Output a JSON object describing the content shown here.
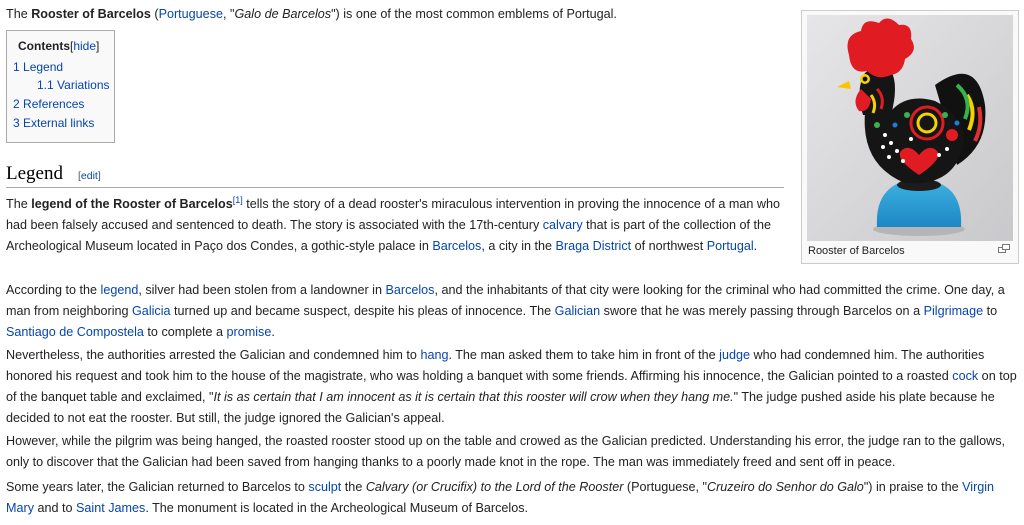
{
  "intro": {
    "t1": "The ",
    "b1": "Rooster of Barcelos",
    "t2": " (",
    "l1": "Portuguese",
    "t3": ", \"",
    "i1": "Galo de Barcelos",
    "t4": "\") is one of the most common emblems of Portugal."
  },
  "toc": {
    "title": "Contents",
    "hide_open": "[",
    "hide_label": "hide",
    "hide_close": "]",
    "items": [
      {
        "num": "1",
        "label": "Legend"
      },
      {
        "num": "1.1",
        "label": "Variations"
      },
      {
        "num": "2",
        "label": "References"
      },
      {
        "num": "3",
        "label": "External links"
      }
    ]
  },
  "heading": {
    "text": "Legend",
    "edit_open": "[",
    "edit_label": "edit",
    "edit_close": "]"
  },
  "thumb": {
    "caption": "Rooster of Barcelos",
    "magnify_icon": "magnify-clip-icon"
  },
  "p1": {
    "t1": "The ",
    "b1": "legend of the Rooster of Barcelos",
    "ref": "[1]",
    "t2": " tells the story of a dead rooster's miraculous intervention in proving the innocence of a man who had been falsely accused and sentenced to death. The story is associated with the 17th-century ",
    "l1": "calvary",
    "t3": " that is part of the collection of the Archeological Museum located in Paço dos Condes, a gothic-style palace in ",
    "l2": "Barcelos",
    "t4": ", a city in the ",
    "l3": "Braga District",
    "t5": " of northwest ",
    "l4": "Portugal",
    "t6": "."
  },
  "p2": {
    "t1": "According to the ",
    "l1": "legend",
    "t2": ", silver had been stolen from a landowner in ",
    "l2": "Barcelos",
    "t3": ", and the inhabitants of that city were looking for the criminal who had committed the crime. One day, a man from neighboring ",
    "l3": "Galicia",
    "t4": " turned up and became suspect, despite his pleas of innocence. The ",
    "l4": "Galician",
    "t5": " swore that he was merely passing through Barcelos on a ",
    "l5": "Pilgrimage",
    "t6": " to ",
    "l6": "Santiago de Compostela",
    "t7": " to complete a ",
    "l7": "promise",
    "t8": "."
  },
  "p3": {
    "t1": "Nevertheless, the authorities arrested the Galician and condemned him to ",
    "l1": "hang",
    "t2": ". The man asked them to take him in front of the ",
    "l2": "judge",
    "t3": " who had condemned him. The authorities honored his request and took him to the house of the magistrate, who was holding a banquet with some friends. Affirming his innocence, the Galician pointed to a roasted ",
    "l3": "cock",
    "t4": " on top of the banquet table and exclaimed, \"",
    "i1": "It is as certain that I am innocent as it is certain that this rooster will crow when they hang me.",
    "t5": "\" The judge pushed aside his plate because he decided to not eat the rooster. But still, the judge ignored the Galician's appeal."
  },
  "p4": {
    "text": "However, while the pilgrim was being hanged, the roasted rooster stood up on the table and crowed as the Galician predicted. Understanding his error, the judge ran to the gallows, only to discover that the Galician had been saved from hanging thanks to a poorly made knot in the rope. The man was immediately freed and sent off in peace."
  },
  "p5": {
    "t1": "Some years later, the Galician returned to Barcelos to ",
    "l1": "sculpt",
    "t2": " the ",
    "i1": "Calvary (or Crucifix) to the Lord of the Rooster",
    "t3": " (Portuguese, \"",
    "i2": "Cruzeiro do Senhor do Galo",
    "t4": "\") in praise to the ",
    "l2": "Virgin Mary",
    "t5": " and to ",
    "l3": "Saint James",
    "t6": ". The monument is located in the Archeological Museum of Barcelos."
  }
}
